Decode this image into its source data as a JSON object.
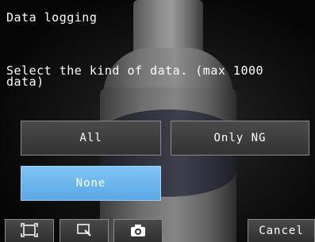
{
  "dialog": {
    "title": "Data logging",
    "instruction": "Select the kind of data. (max 1000 data)"
  },
  "options": {
    "all_label": "All",
    "only_ng_label": "Only NG",
    "none_label": "None",
    "selected": "None"
  },
  "toolbar": {
    "tool_icons": [
      "fit-screen-icon",
      "zoom-icon",
      "camera-icon"
    ],
    "cancel_label": "Cancel"
  },
  "colors": {
    "selected_button": "#6ab6ee",
    "button": "#3d3d3d",
    "button_border": "#8a8a8a",
    "text": "#ffffff",
    "background": "#000000"
  }
}
